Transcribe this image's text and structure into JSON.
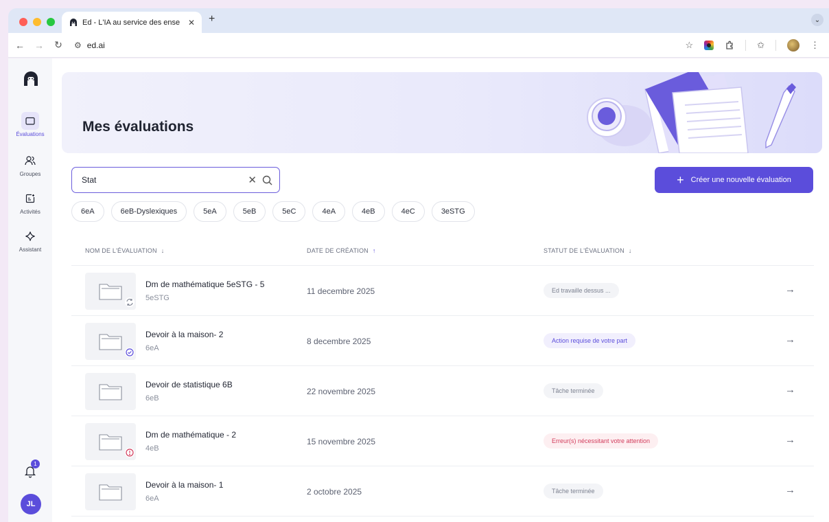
{
  "browser": {
    "tab_title": "Ed - L'IA au service des ense",
    "url": "ed.ai"
  },
  "sidebar": {
    "items": [
      {
        "label": "Évaluations",
        "icon": "folder-icon",
        "active": true
      },
      {
        "label": "Groupes",
        "icon": "users-icon",
        "active": false
      },
      {
        "label": "Activités",
        "icon": "activities-icon",
        "active": false
      },
      {
        "label": "Assistant",
        "icon": "sparkle-icon",
        "active": false
      }
    ],
    "notification_count": "1",
    "user_initials": "JL"
  },
  "header": {
    "title": "Mes évaluations"
  },
  "search": {
    "value": "Stat"
  },
  "create_button": {
    "label": "Créer une nouvelle évaluation"
  },
  "filters": [
    "6eA",
    "6eB-Dyslexiques",
    "5eA",
    "5eB",
    "5eC",
    "4eA",
    "4eB",
    "4eC",
    "3eSTG"
  ],
  "table": {
    "columns": [
      {
        "label": "NOM DE L'ÉVALUATION",
        "sort": "desc"
      },
      {
        "label": "DATE DE CRÉATION",
        "sort": "asc"
      },
      {
        "label": "STATUT DE L'ÉVALUATION",
        "sort": "desc"
      }
    ],
    "rows": [
      {
        "name": "Dm de mathématique 5eSTG  - 5",
        "group": "5eSTG",
        "date": "11 decembre 2025",
        "status": "Ed travaille dessus ...",
        "status_type": "gray",
        "indicator": "sync-icon"
      },
      {
        "name": "Devoir à la maison- 2",
        "group": "6eA",
        "date": "8 decembre 2025",
        "status": "Action requise de votre part",
        "status_type": "purple",
        "indicator": "check-circle-icon"
      },
      {
        "name": "Devoir de statistique 6B",
        "group": "6eB",
        "date": "22 novembre 2025",
        "status": "Tâche terminée",
        "status_type": "gray",
        "indicator": ""
      },
      {
        "name": "Dm de mathématique - 2",
        "group": "4eB",
        "date": "15 novembre 2025",
        "status": "Erreur(s) nécessitant votre attention",
        "status_type": "red",
        "indicator": "alert-circle-icon"
      },
      {
        "name": "Devoir à la maison- 1",
        "group": "6eA",
        "date": "2 octobre 2025",
        "status": "Tâche terminée",
        "status_type": "gray",
        "indicator": ""
      }
    ]
  },
  "colors": {
    "accent": "#5b4ddb",
    "error": "#d23c5c"
  }
}
